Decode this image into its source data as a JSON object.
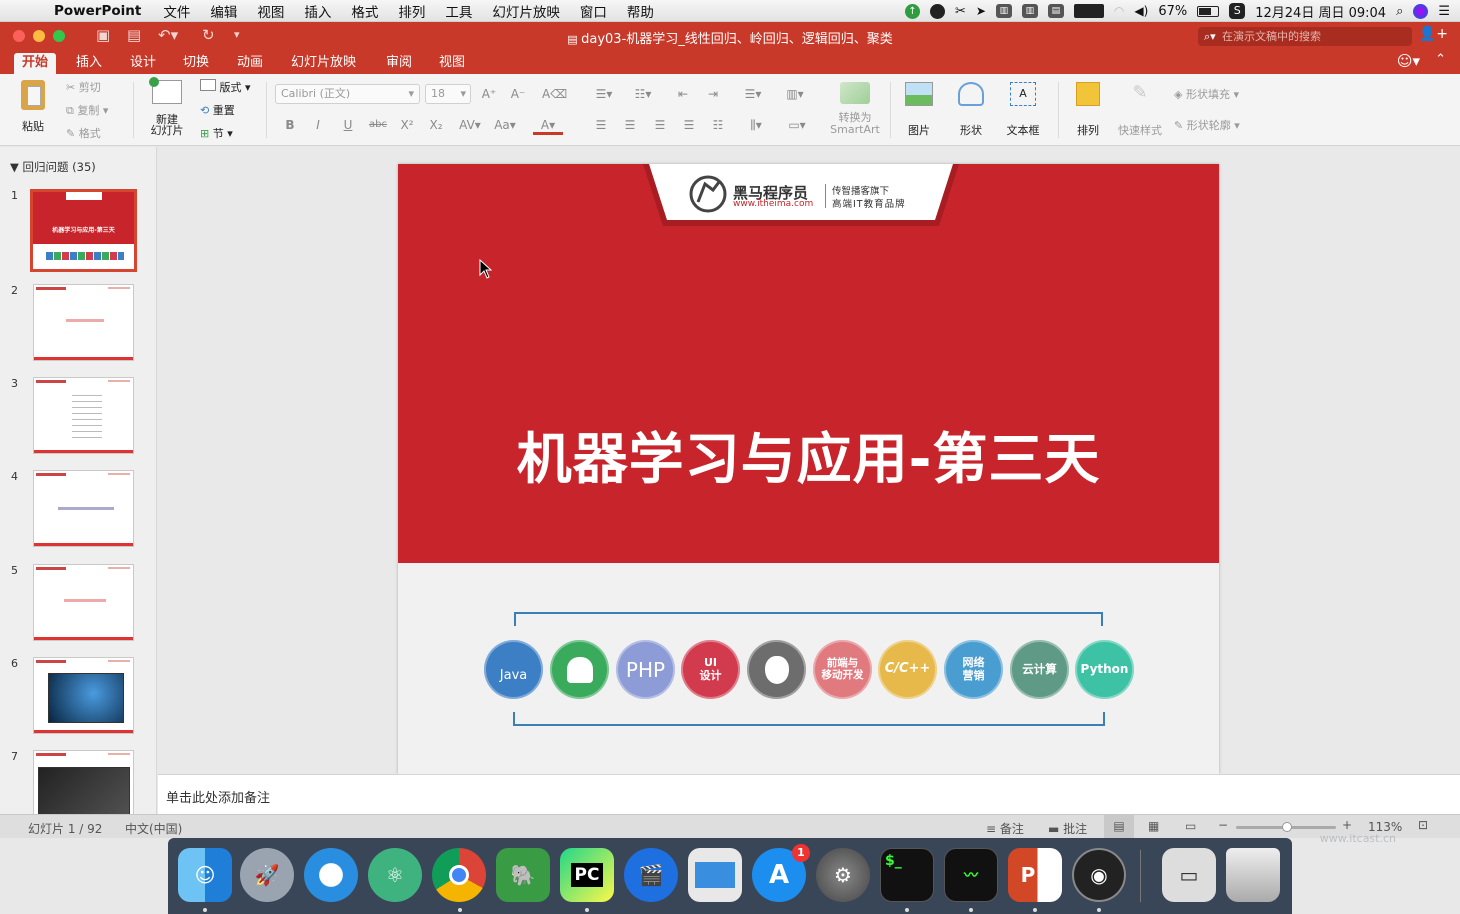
{
  "menubar": {
    "app_name": "PowerPoint",
    "items": [
      "文件",
      "编辑",
      "视图",
      "插入",
      "格式",
      "排列",
      "工具",
      "幻灯片放映",
      "窗口",
      "帮助"
    ],
    "battery": "67%",
    "datetime": "12月24日 周日 09:04"
  },
  "window": {
    "title": "day03-机器学习_线性回归、岭回归、逻辑回归、聚类",
    "search_placeholder": "在演示文稿中的搜索"
  },
  "ribbon_tabs": [
    "开始",
    "插入",
    "设计",
    "切换",
    "动画",
    "幻灯片放映",
    "审阅",
    "视图"
  ],
  "ribbon": {
    "paste": "粘贴",
    "cut": "剪切",
    "copy": "复制",
    "format": "格式",
    "new_slide": "新建\n幻灯片",
    "layout": "版式",
    "reset": "重置",
    "section": "节",
    "font_name": "Calibri (正文)",
    "font_size": "18",
    "convert_smartart_1": "转换为",
    "convert_smartart_2": "SmartArt",
    "picture": "图片",
    "shape": "形状",
    "textbox": "文本框",
    "arrange": "排列",
    "quick_styles": "快速样式",
    "shape_fill": "形状填充",
    "shape_outline": "形状轮廓"
  },
  "left_panel": {
    "section_title": "回归问题 (35)",
    "thumb_numbers": [
      "1",
      "2",
      "3",
      "4",
      "5",
      "6",
      "7"
    ],
    "slide1_title": "机器学习与应用-第三天"
  },
  "slide": {
    "logo_brand": "黑马程序员",
    "logo_url": "www.itheima.com",
    "logo_tag1": "传智播客旗下",
    "logo_tag2": "高端IT教育品牌",
    "title": "机器学习与应用-第三天",
    "circles": [
      {
        "label": "Java",
        "color": "#3d7fc4"
      },
      {
        "label": "",
        "color": "#3aaa5c"
      },
      {
        "label": "PHP",
        "color": "#8d9bd6"
      },
      {
        "label": "UI\n设计",
        "color": "#d23a4e"
      },
      {
        "label": "",
        "color": "#6d6d6d"
      },
      {
        "label": "前端与\n移动开发",
        "color": "#e07a7f"
      },
      {
        "label": "C/C++",
        "color": "#e6b94a"
      },
      {
        "label": "网络\n营销",
        "color": "#4a9dd0"
      },
      {
        "label": "云计算",
        "color": "#5f9a86"
      },
      {
        "label": "Python",
        "color": "#3ec2a5"
      }
    ]
  },
  "notes_placeholder": "单击此处添加备注",
  "status": {
    "slide_counter": "幻灯片 1 / 92",
    "language": "中文(中国)",
    "notes": "备注",
    "comments": "批注",
    "zoom": "113%"
  },
  "dock": {
    "badge": "1",
    "watermark": "www.itcast.cn"
  }
}
